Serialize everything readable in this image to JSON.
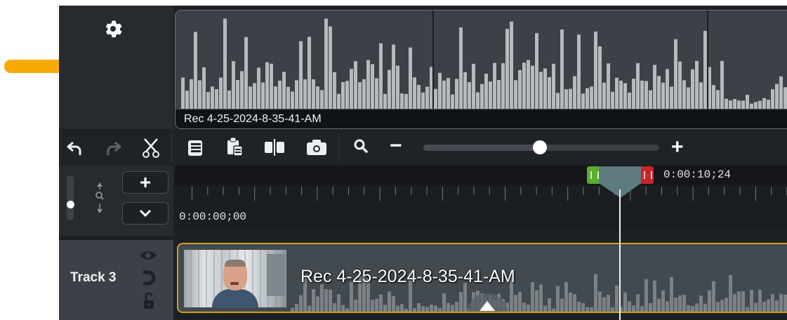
{
  "arrow": {
    "color": "#f7ab00"
  },
  "media_waveform": {
    "label": "Rec 4-25-2024-8-35-41-AM"
  },
  "toolbar": {
    "undo": "undo-icon",
    "redo": "redo-icon",
    "cut": "scissors-icon",
    "copy": "copy-icon",
    "paste": "paste-icon",
    "split": "split-icon",
    "snapshot": "camera-icon",
    "zoom": "magnifier-icon",
    "zoom_minus": "−",
    "zoom_plus": "+",
    "zoom_level": 0.49
  },
  "track_controls": {
    "add": "+",
    "collapse": "chevron-down-icon"
  },
  "timeline": {
    "start_time": "0:00:00;00",
    "playhead_time": "0:00:10;24"
  },
  "track": {
    "name": "Track 3",
    "clip_title": "Rec 4-25-2024-8-35-41-AM"
  },
  "colors": {
    "selection_outline": "#d3a11d",
    "in_marker": "#5bae2f",
    "out_marker": "#c9262b",
    "playhead": "#5e7b80"
  }
}
